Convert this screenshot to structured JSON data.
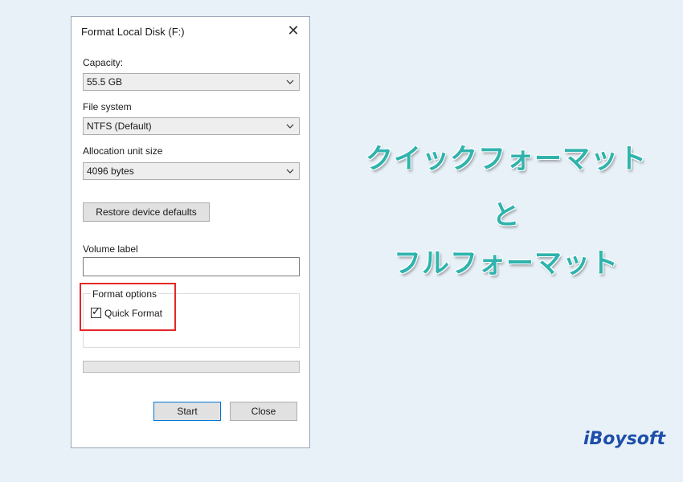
{
  "dialog": {
    "title": "Format Local Disk (F:)",
    "close_glyph": "✕",
    "capacity": {
      "label": "Capacity:",
      "value": "55.5 GB"
    },
    "file_system": {
      "label": "File system",
      "value": "NTFS (Default)"
    },
    "allocation": {
      "label": "Allocation unit size",
      "value": "4096 bytes"
    },
    "restore_button": "Restore device defaults",
    "volume_label": {
      "label": "Volume label",
      "value": ""
    },
    "format_options": {
      "label": "Format options",
      "quick_format_label": "Quick Format",
      "quick_format_checked": "✓"
    },
    "progress": 0,
    "start_button": "Start",
    "close_button": "Close"
  },
  "headline": {
    "line1": "クイックフォーマット",
    "line2": "と",
    "line3": "フルフォーマット"
  },
  "brand": "iBoysoft",
  "colors": {
    "headline": "#2fb3ad",
    "highlight": "#e52727",
    "brand": "#1e4fa8",
    "accent_button_border": "#0078d7"
  }
}
